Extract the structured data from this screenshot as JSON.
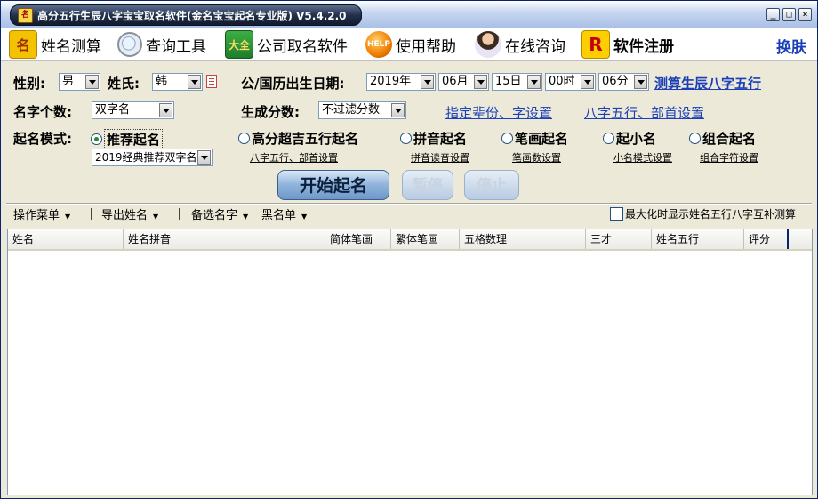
{
  "window": {
    "title": "高分五行生辰八字宝宝取名软件(金名宝宝起名专业版) V5.4.2.0"
  },
  "toolbar": {
    "items": [
      {
        "label": "姓名测算",
        "icon": "name-test-icon"
      },
      {
        "label": "查询工具",
        "icon": "magnifier-icon"
      },
      {
        "label": "公司取名软件",
        "icon": "book-icon"
      },
      {
        "label": "使用帮助",
        "icon": "help-icon"
      },
      {
        "label": "在线咨询",
        "icon": "consultant-icon"
      },
      {
        "label": "软件注册",
        "icon": "register-icon"
      }
    ],
    "skin_label": "换肤"
  },
  "form": {
    "gender_label": "性别:",
    "gender_value": "男",
    "surname_label": "姓氏:",
    "surname_value": "韩",
    "birthdate_label": "公/国历出生日期:",
    "year_value": "2019年",
    "month_value": "06月",
    "day_value": "15日",
    "hour_value": "00时",
    "minute_value": "06分",
    "bazi_link": "测算生辰八字五行",
    "name_count_label": "名字个数:",
    "name_count_value": "双字名",
    "score_label": "生成分数:",
    "score_value": "不过滤分数",
    "generation_link": "指定辈份、字设置",
    "wuxing_link": "八字五行、部首设置",
    "mode_label": "起名模式:",
    "modes": [
      {
        "label": "推荐起名",
        "selected": true
      },
      {
        "label": "高分超吉五行起名",
        "selected": false,
        "sublink": "八字五行、部首设置"
      },
      {
        "label": "拼音起名",
        "selected": false,
        "sublink": "拼音读音设置"
      },
      {
        "label": "笔画起名",
        "selected": false,
        "sublink": "笔画数设置"
      },
      {
        "label": "起小名",
        "selected": false,
        "sublink": "小名模式设置"
      },
      {
        "label": "组合起名",
        "selected": false,
        "sublink": "组合字符设置"
      }
    ],
    "recommend_value": "2019经典推荐双字名"
  },
  "actions": {
    "start_label": "开始起名",
    "pause_label": "暂停",
    "stop_label": "停止"
  },
  "menubar": {
    "ops_label": "操作菜单",
    "export_label": "导出姓名",
    "candidates_label": "备选名字",
    "blacklist_label": "黑名单",
    "maximize_checkbox_label": "最大化时显示姓名五行八字互补测算"
  },
  "table": {
    "columns": [
      "姓名",
      "姓名拼音",
      "简体笔画",
      "繁体笔画",
      "五格数理",
      "三才",
      "姓名五行",
      "评分"
    ],
    "rows": []
  }
}
